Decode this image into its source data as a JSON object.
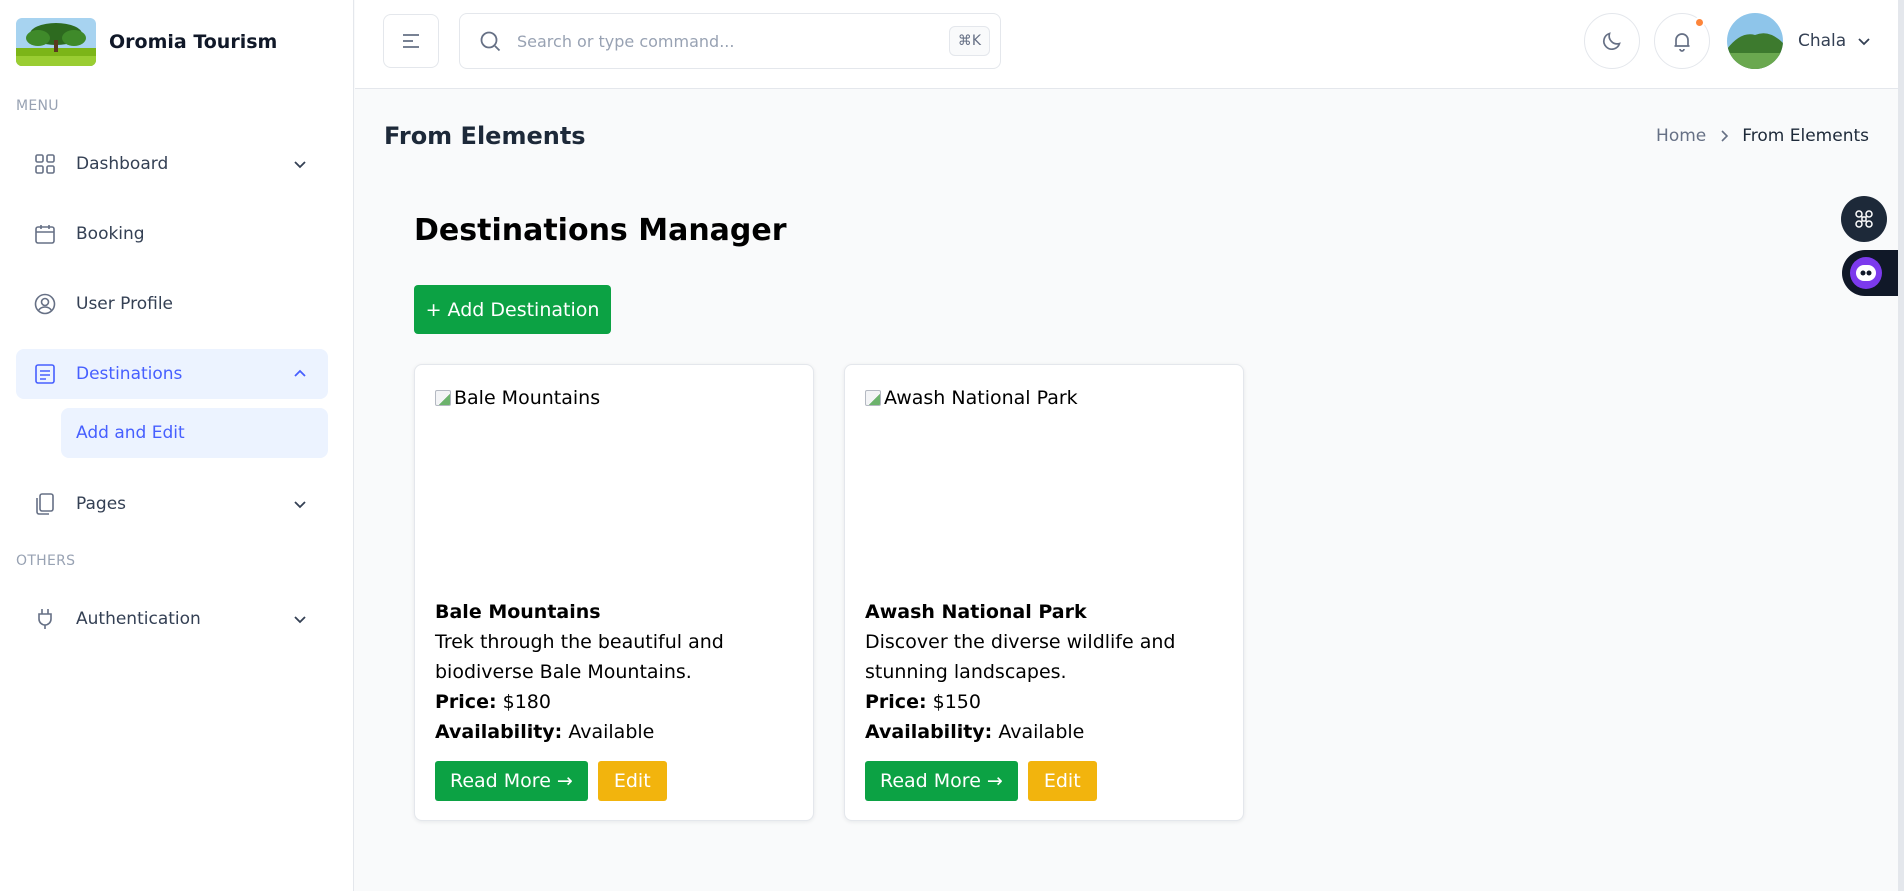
{
  "brand": {
    "name": "Oromia Tourism",
    "logo_icon": "tree-landscape-logo"
  },
  "sidebar": {
    "menu_label": "MENU",
    "others_label": "OTHERS",
    "items": [
      {
        "label": "Dashboard",
        "icon": "grid-icon",
        "has_chevron": true
      },
      {
        "label": "Booking",
        "icon": "calendar-icon",
        "has_chevron": false
      },
      {
        "label": "User Profile",
        "icon": "user-circle-icon",
        "has_chevron": false
      },
      {
        "label": "Destinations",
        "icon": "list-icon",
        "has_chevron": true,
        "expanded": true
      },
      {
        "label": "Pages",
        "icon": "pages-icon",
        "has_chevron": true
      },
      {
        "label": "Authentication",
        "icon": "plug-icon",
        "has_chevron": true
      }
    ],
    "sub_items": [
      {
        "label": "Add and Edit"
      }
    ]
  },
  "header": {
    "search_placeholder": "Search or type command...",
    "search_shortcut": "⌘K",
    "user_name": "Chala"
  },
  "page": {
    "title": "From Elements",
    "breadcrumb": {
      "home": "Home",
      "current": "From Elements"
    }
  },
  "main": {
    "heading": "Destinations Manager",
    "add_button": "+ Add Destination",
    "price_label": "Price:",
    "availability_label": "Availability:",
    "read_more_label": "Read More →",
    "edit_label": "Edit",
    "cards": [
      {
        "image_alt": "Bale Mountains",
        "title": "Bale Mountains",
        "description": "Trek through the beautiful and biodiverse Bale Mountains.",
        "price": "$180",
        "availability": "Available"
      },
      {
        "image_alt": "Awash National Park",
        "title": "Awash National Park",
        "description": "Discover the diverse wildlife and stunning landscapes.",
        "price": "$150",
        "availability": "Available"
      }
    ]
  },
  "colors": {
    "accent": "#465fff",
    "active_bg": "#ecf3ff",
    "green": "#0ca244",
    "yellow": "#f2b40d",
    "notification_dot": "#fd853a"
  }
}
